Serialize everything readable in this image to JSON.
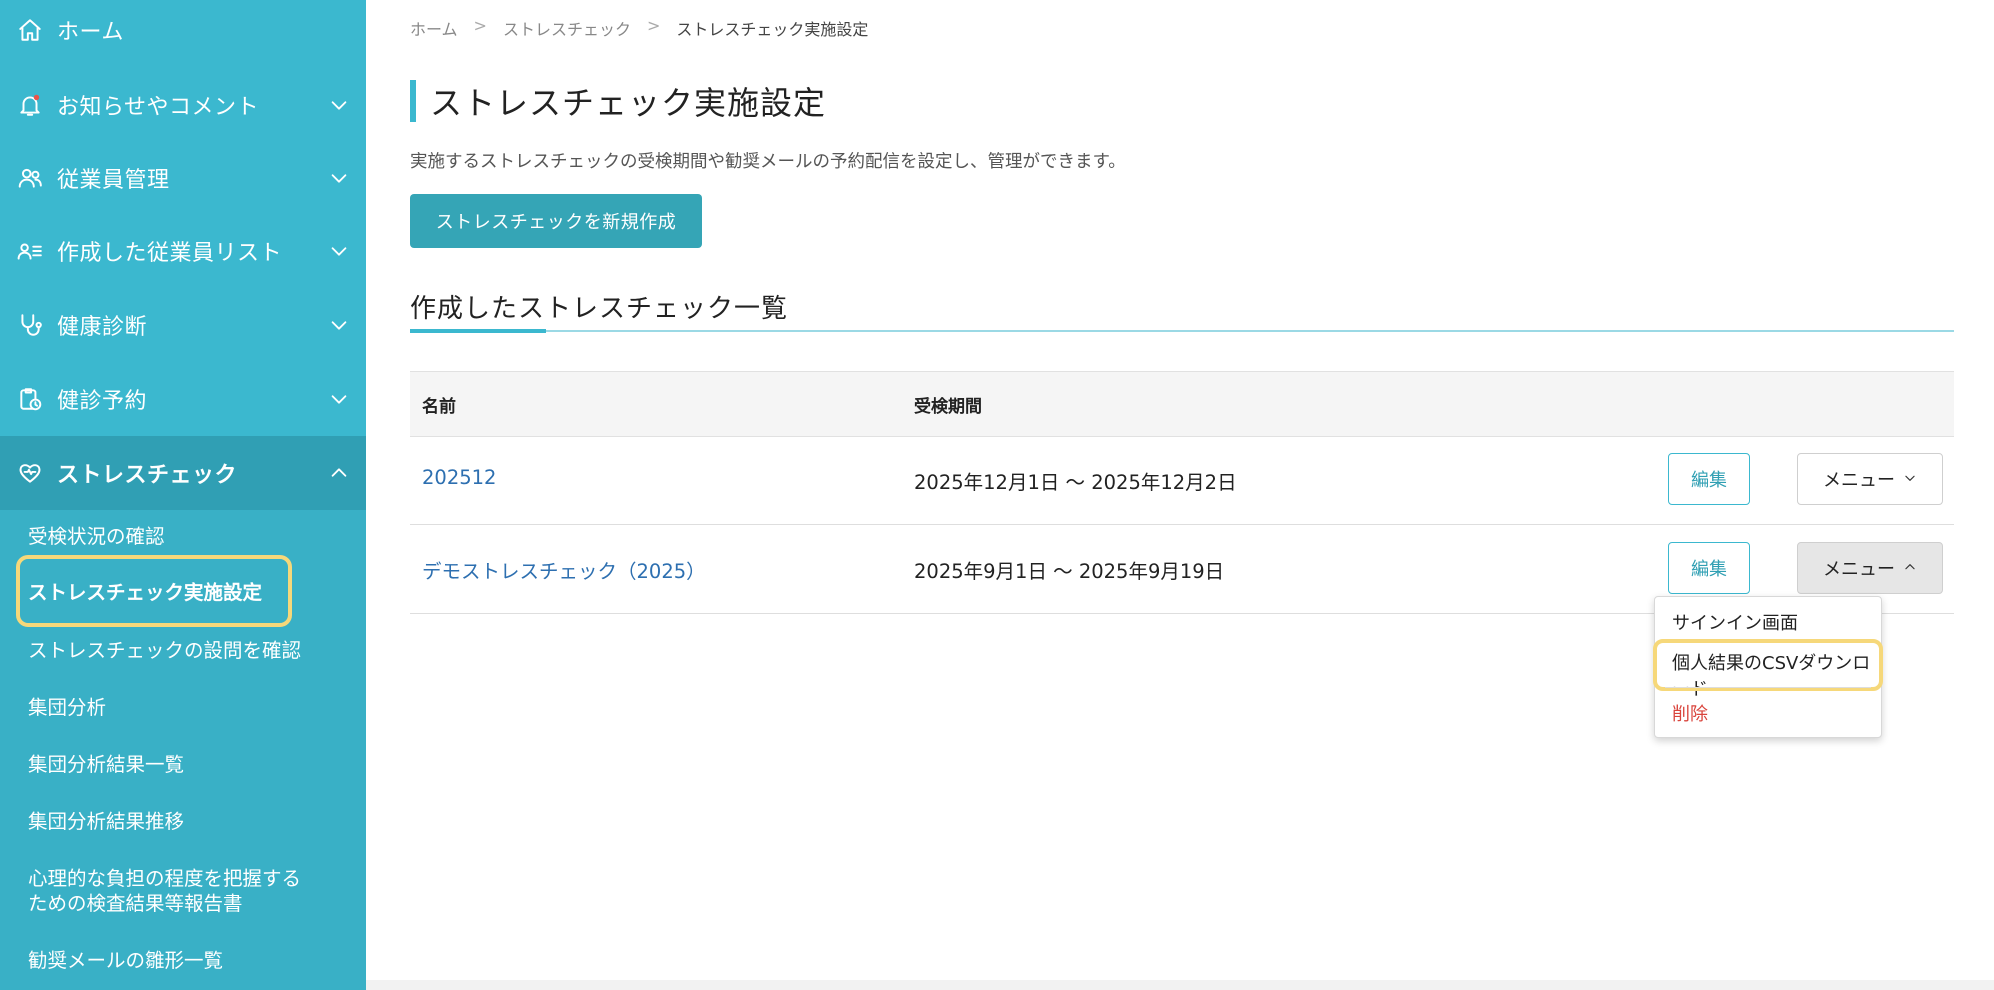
{
  "sidebar": {
    "items": [
      {
        "label": "ホーム",
        "icon": "home-icon"
      },
      {
        "label": "お知らせやコメント",
        "icon": "bell-icon"
      },
      {
        "label": "従業員管理",
        "icon": "users-icon"
      },
      {
        "label": "作成した従業員リスト",
        "icon": "user-list-icon"
      },
      {
        "label": "健康診断",
        "icon": "stethoscope-icon"
      },
      {
        "label": "健診予約",
        "icon": "clipboard-clock-icon"
      },
      {
        "label": "ストレスチェック",
        "icon": "heart-icon"
      }
    ],
    "subitems": [
      "受検状況の確認",
      "ストレスチェック実施設定",
      "ストレスチェックの設問を確認",
      "集団分析",
      "集団分析結果一覧",
      "集団分析結果推移",
      "心理的な負担の程度を把握する",
      "ための検査結果等報告書",
      "勧奨メールの雛形一覧"
    ],
    "colors": {
      "background": "#3bb8cf",
      "active": "#309fb4",
      "highlight": "#f6d87a"
    }
  },
  "breadcrumb": [
    "ホーム",
    "ストレスチェック",
    "ストレスチェック実施設定"
  ],
  "breadcrumb_separator": ">",
  "page": {
    "title": "ストレスチェック実施設定",
    "description": "実施するストレスチェックの受検期間や勧奨メールの予約配信を設定し、管理ができます。",
    "new_button": "ストレスチェックを新規作成",
    "section_title": "作成したストレスチェック一覧"
  },
  "table": {
    "headers": {
      "name": "名前",
      "period": "受検期間"
    },
    "rows": [
      {
        "name": "202512",
        "period": "2025年12月1日 〜 2025年12月2日",
        "edit": "編集",
        "menu": "メニュー"
      },
      {
        "name": "デモストレスチェック（2025）",
        "period": "2025年9月1日 〜 2025年9月19日",
        "edit": "編集",
        "menu": "メニュー"
      }
    ]
  },
  "dropdown": {
    "items": [
      "サインイン画面",
      "個人結果のCSVダウンロード",
      "削除"
    ]
  }
}
